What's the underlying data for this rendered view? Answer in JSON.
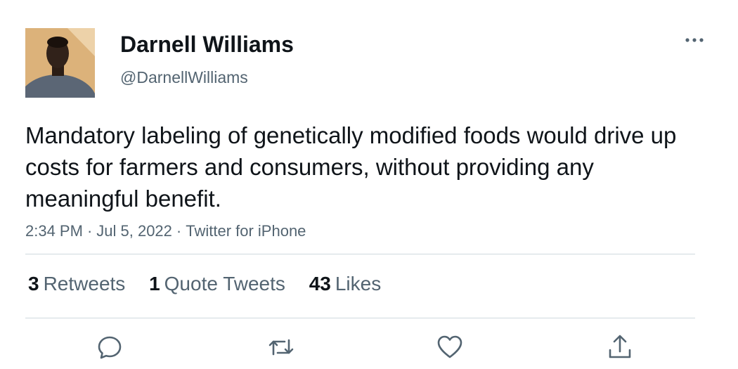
{
  "user": {
    "display_name": "Darnell Williams",
    "handle": "@DarnellWilliams"
  },
  "tweet": {
    "text": "Mandatory labeling of genetically modified foods would drive up costs for farmers and consumers, without providing any meaningful benefit.",
    "time": "2:34 PM",
    "date": "Jul 5, 2022",
    "source": "Twitter for iPhone",
    "separator": "·"
  },
  "stats": {
    "retweets_count": "3",
    "retweets_label": "Retweets",
    "quotes_count": "1",
    "quotes_label": "Quote Tweets",
    "likes_count": "43",
    "likes_label": "Likes"
  },
  "icons": {
    "more": "more-dots-icon",
    "reply": "reply-icon",
    "retweet": "retweet-icon",
    "like": "heart-icon",
    "share": "share-icon"
  },
  "colors": {
    "text_primary": "#0f1419",
    "text_secondary": "#536471",
    "divider": "#cfd9de"
  }
}
